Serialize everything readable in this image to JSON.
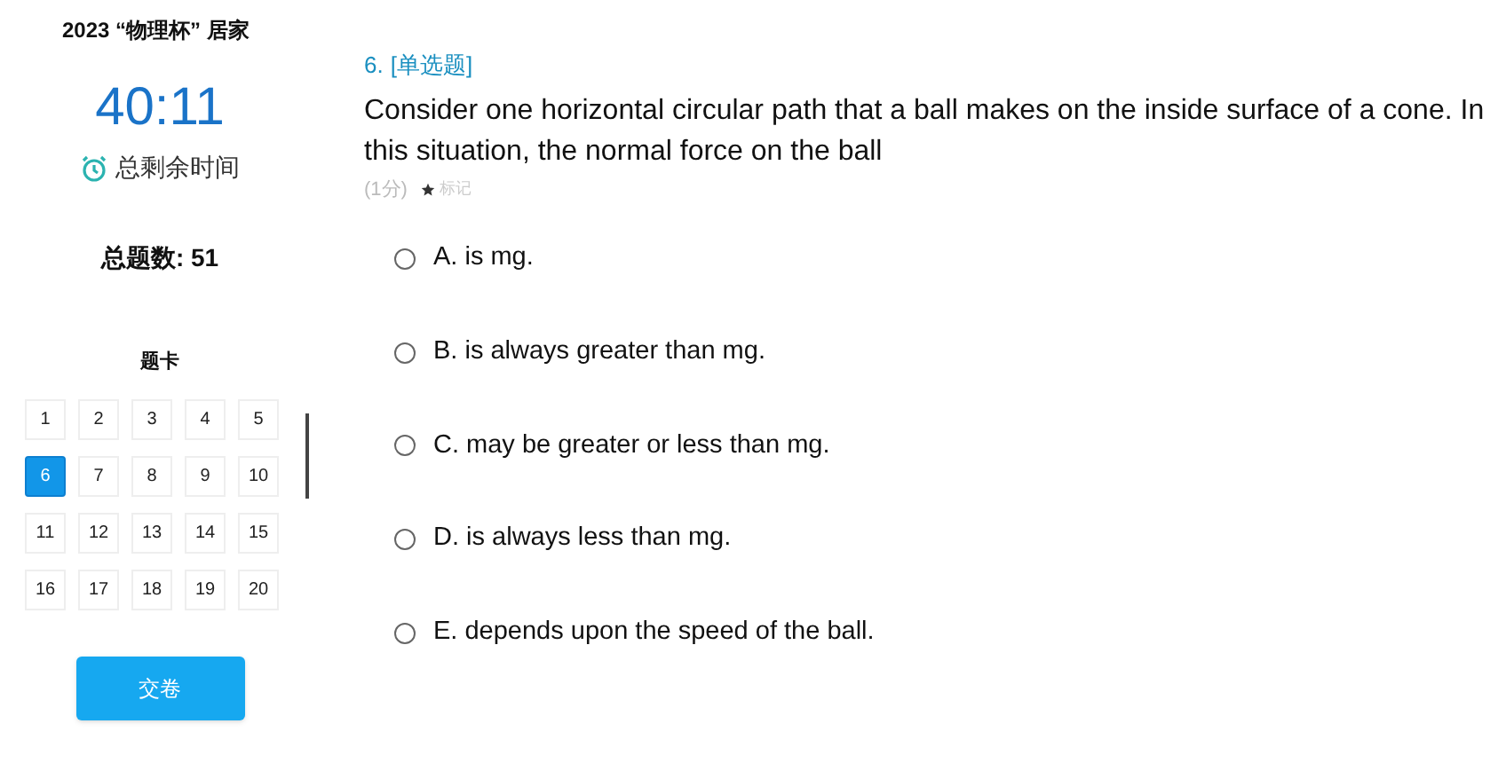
{
  "exam_title": "2023 “物理杯” 居家",
  "timer": {
    "time": "40:11",
    "label": "总剩余时间"
  },
  "total": "总题数: 51",
  "answer_card": {
    "title": "题卡",
    "cells": [
      {
        "label": "1",
        "selected": false
      },
      {
        "label": "2",
        "selected": false
      },
      {
        "label": "3",
        "selected": false
      },
      {
        "label": "4",
        "selected": false
      },
      {
        "label": "5",
        "selected": false
      },
      {
        "label": "6",
        "selected": true
      },
      {
        "label": "7",
        "selected": false
      },
      {
        "label": "8",
        "selected": false
      },
      {
        "label": "9",
        "selected": false
      },
      {
        "label": "10",
        "selected": false
      },
      {
        "label": "11",
        "selected": false
      },
      {
        "label": "12",
        "selected": false
      },
      {
        "label": "13",
        "selected": false
      },
      {
        "label": "14",
        "selected": false
      },
      {
        "label": "15",
        "selected": false
      },
      {
        "label": "16",
        "selected": false
      },
      {
        "label": "17",
        "selected": false
      },
      {
        "label": "18",
        "selected": false
      },
      {
        "label": "19",
        "selected": false
      },
      {
        "label": "20",
        "selected": false
      }
    ]
  },
  "submit_button": "交卷",
  "question": {
    "number": "6.",
    "type": "[单选题]",
    "text": "Consider one horizontal circular path that a ball makes on the inside surface of a cone. In this situation, the normal force on the ball",
    "score": "(1分)",
    "mark": "标记",
    "options": [
      {
        "label": "A. is mg.",
        "selected": false
      },
      {
        "label": "B. is always greater than mg.",
        "selected": false
      },
      {
        "label": "C. may be greater or less than mg.",
        "selected": false
      },
      {
        "label": "D. is always less than mg.",
        "selected": false
      },
      {
        "label": "E. depends upon the speed of the ball.",
        "selected": false
      }
    ]
  }
}
